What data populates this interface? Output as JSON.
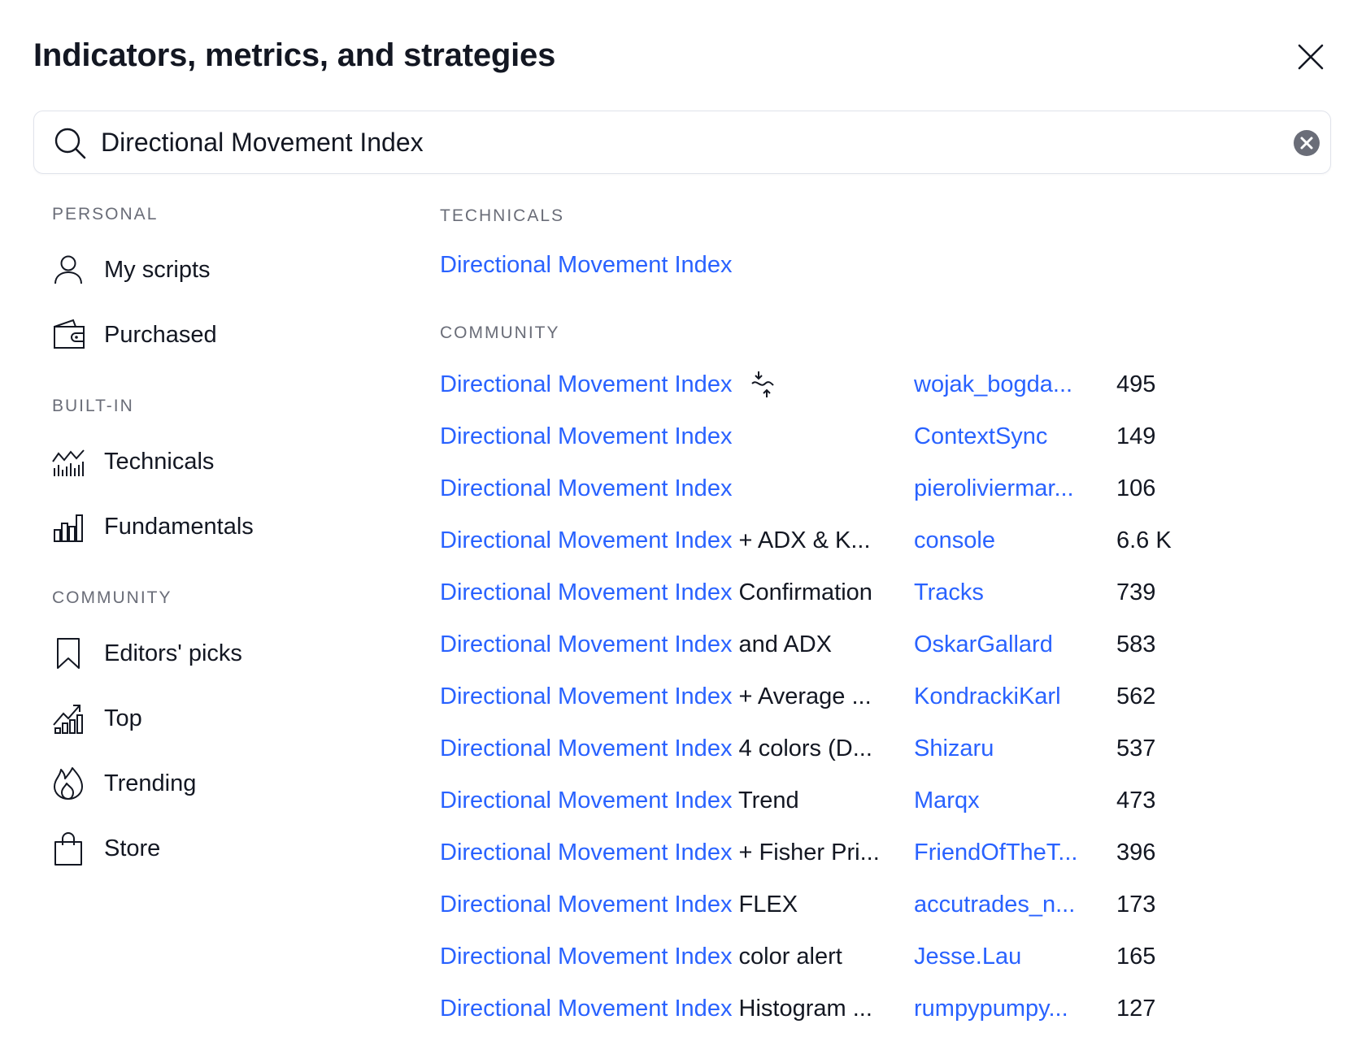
{
  "dialog": {
    "title": "Indicators, metrics, and strategies"
  },
  "search": {
    "value": "Directional Movement Index",
    "placeholder": "Search"
  },
  "sidebar": {
    "personal_label": "PERSONAL",
    "personal_items": [
      {
        "label": "My scripts",
        "icon": "user-icon"
      },
      {
        "label": "Purchased",
        "icon": "wallet-icon"
      }
    ],
    "builtin_label": "BUILT-IN",
    "builtin_items": [
      {
        "label": "Technicals",
        "icon": "technicals-chart-icon"
      },
      {
        "label": "Fundamentals",
        "icon": "bar-chart-icon"
      }
    ],
    "community_label": "COMMUNITY",
    "community_items": [
      {
        "label": "Editors' picks",
        "icon": "bookmark-icon"
      },
      {
        "label": "Top",
        "icon": "top-chart-icon"
      },
      {
        "label": "Trending",
        "icon": "flame-icon"
      },
      {
        "label": "Store",
        "icon": "shopping-bag-icon"
      }
    ]
  },
  "results": {
    "technicals_label": "TECHNICALS",
    "technicals": [
      {
        "title": "Directional Movement Index"
      }
    ],
    "community_label": "COMMUNITY",
    "community": [
      {
        "match": "Directional Movement Index",
        "rest": "",
        "author": "wojak_bogda...",
        "count": "495",
        "badge": "strategy-badge-icon"
      },
      {
        "match": "Directional Movement Index",
        "rest": "",
        "author": "ContextSync",
        "count": "149"
      },
      {
        "match": "Directional Movement Index",
        "rest": "",
        "author": "pieroliviermar...",
        "count": "106"
      },
      {
        "match": "Directional Movement Index",
        "rest": " + ADX & K...",
        "author": "console",
        "count": "6.6 K"
      },
      {
        "match": "Directional Movement Index",
        "rest": " Confirmation",
        "author": "Tracks",
        "count": "739"
      },
      {
        "match": "Directional Movement Index",
        "rest": " and ADX",
        "author": "OskarGallard",
        "count": "583"
      },
      {
        "match": "Directional Movement Index",
        "rest": " + Average ...",
        "author": "KondrackiKarl",
        "count": "562"
      },
      {
        "match": "Directional Movement Index",
        "rest": " 4 colors (D...",
        "author": "Shizaru",
        "count": "537"
      },
      {
        "match": "Directional Movement Index",
        "rest": " Trend",
        "author": "Marqx",
        "count": "473"
      },
      {
        "match": "Directional Movement Index",
        "rest": " + Fisher Pri...",
        "author": "FriendOfTheT...",
        "count": "396"
      },
      {
        "match": "Directional Movement Index",
        "rest": " FLEX",
        "author": "accutrades_n...",
        "count": "173"
      },
      {
        "match": "Directional Movement Index",
        "rest": " color alert",
        "author": "Jesse.Lau",
        "count": "165"
      },
      {
        "match": "Directional Movement Index",
        "rest": " Histogram ...",
        "author": "rumpypumpy...",
        "count": "127"
      }
    ]
  },
  "colors": {
    "accent": "#2962ff",
    "text": "#131722",
    "muted": "#6a6d78",
    "border": "#e0e3eb"
  }
}
